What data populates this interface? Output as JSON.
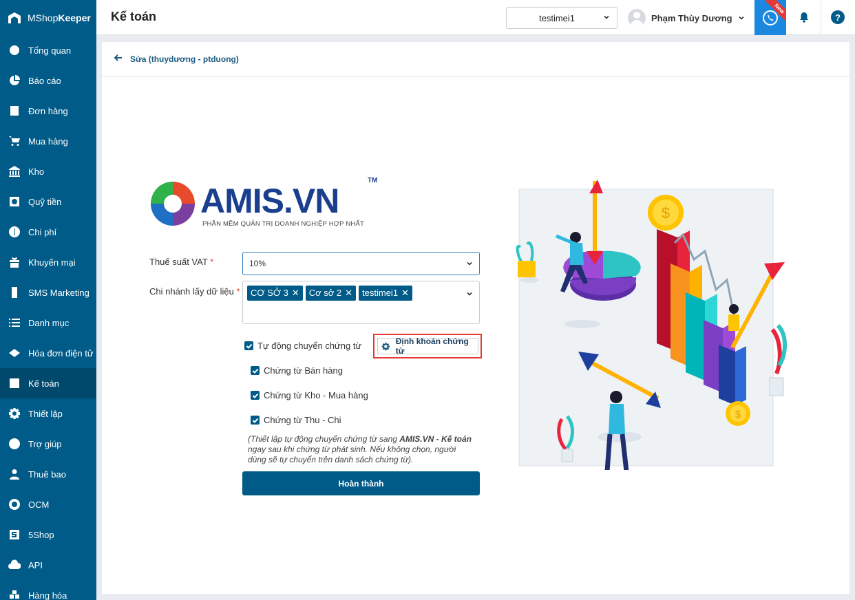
{
  "brand": {
    "name_light": "MShop",
    "name_bold": "Keeper"
  },
  "sidebar": {
    "items": [
      {
        "label": "Tổng quan",
        "icon": "dashboard-icon"
      },
      {
        "label": "Báo cáo",
        "icon": "pie-chart-icon"
      },
      {
        "label": "Đơn hàng",
        "icon": "order-icon"
      },
      {
        "label": "Mua hàng",
        "icon": "cart-icon"
      },
      {
        "label": "Kho",
        "icon": "warehouse-icon"
      },
      {
        "label": "Quỹ tiền",
        "icon": "safe-icon"
      },
      {
        "label": "Chi phí",
        "icon": "expense-icon"
      },
      {
        "label": "Khuyến mại",
        "icon": "gift-icon"
      },
      {
        "label": "SMS Marketing",
        "icon": "phone-icon"
      },
      {
        "label": "Danh mục",
        "icon": "list-icon"
      },
      {
        "label": "Hóa đơn điện tử",
        "icon": "invoice-icon"
      },
      {
        "label": "Kế toán",
        "icon": "calculator-icon",
        "active": true
      },
      {
        "label": "Thiết lập",
        "icon": "gear-icon"
      },
      {
        "label": "Trợ giúp",
        "icon": "help-icon"
      },
      {
        "label": "Thuê bao",
        "icon": "user-icon"
      },
      {
        "label": "OCM",
        "icon": "ocm-icon"
      },
      {
        "label": "5Shop",
        "icon": "5shop-icon"
      },
      {
        "label": "API",
        "icon": "cloud-icon"
      },
      {
        "label": "Hàng hóa",
        "icon": "goods-icon"
      }
    ]
  },
  "header": {
    "title": "Kế toán",
    "branch_value": "testimei1",
    "user_name": "Phạm Thùy Dương",
    "new_badge": "New",
    "help_symbol": "?"
  },
  "panel": {
    "back_label": "Sửa (thuydương - ptduong)"
  },
  "logo": {
    "word": "AMIS.VN",
    "tm": "TM",
    "tagline": "PHẦN MỀM QUẢN TRỊ DOANH NGHIỆP HỢP NHẤT"
  },
  "form": {
    "vat_label": "Thuế suất VAT",
    "vat_value": "10%",
    "branch_label": "Chi nhánh lấy dữ liệu",
    "branch_tags": [
      "CƠ SỞ 3",
      "Cơ sở 2",
      "testimei1"
    ],
    "auto_transfer_label": "Tự động chuyển chứng từ",
    "config_button": "Định khoản chứng từ",
    "sub_options": [
      "Chứng từ Bán hàng",
      "Chứng từ Kho - Mua hàng",
      "Chứng từ Thu - Chi"
    ],
    "note_prefix": "(Thiết lập tự động chuyển chứng từ sang ",
    "note_bold": "AMIS.VN - Kế toán",
    "note_suffix": " ngay sau khi chứng từ phát sinh. Nếu không chọn, người dùng sẽ tự chuyển trên danh sách chứng từ).",
    "finish_button": "Hoàn thành"
  },
  "colors": {
    "sidebar": "#005b89",
    "sidebar_active": "#00496d",
    "accent_blue": "#1b88e0",
    "highlight_red": "#e53935"
  }
}
